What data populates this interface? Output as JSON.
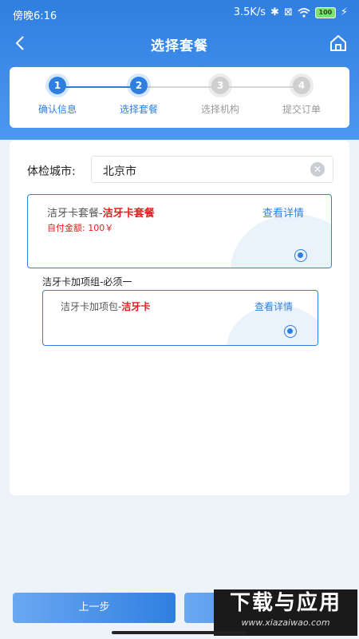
{
  "status_bar": {
    "time": "傍晚6:16",
    "speed": "3.5K/s",
    "battery": "100"
  },
  "nav": {
    "title": "选择套餐"
  },
  "steps": [
    {
      "num": "1",
      "label": "确认信息",
      "state": "done"
    },
    {
      "num": "2",
      "label": "选择套餐",
      "state": "active"
    },
    {
      "num": "3",
      "label": "选择机构",
      "state": "pending"
    },
    {
      "num": "4",
      "label": "提交订单",
      "state": "pending"
    }
  ],
  "city": {
    "label": "体检城市:",
    "value": "北京市"
  },
  "package": {
    "prefix": "洁牙卡套餐-",
    "name": "洁牙卡套餐",
    "detail_link": "查看详情",
    "price_label": "自付金额: 100￥",
    "selected": true
  },
  "addon_group": {
    "title": "洁牙卡加项组-必须一",
    "item": {
      "prefix": "洁牙卡加项包-",
      "name": "洁牙卡",
      "detail_link": "查看详情",
      "selected": true
    }
  },
  "buttons": {
    "prev": "上一步",
    "next": ""
  },
  "watermark": {
    "title": "下载与应用",
    "site": "www.xiazaiwao.com"
  },
  "colors": {
    "primary": "#2f7fe0",
    "highlight": "#e02020"
  }
}
